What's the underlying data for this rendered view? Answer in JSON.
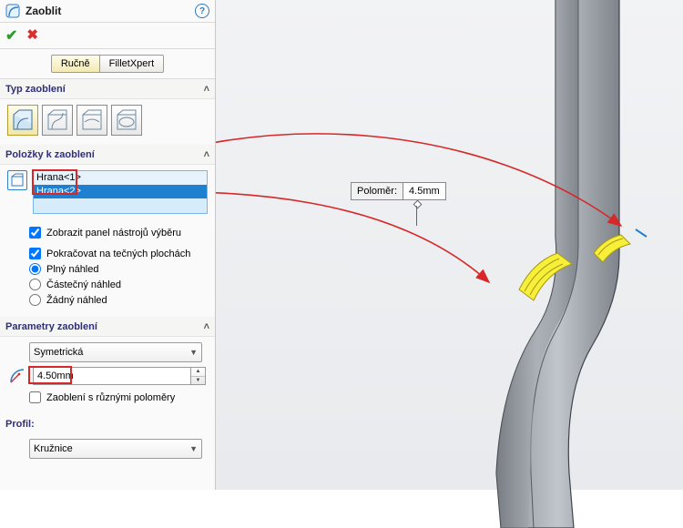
{
  "header": {
    "title": "Zaoblit"
  },
  "tabs": {
    "manual": "Ručně",
    "xpert": "FilletXpert"
  },
  "typeSection": {
    "title": "Typ zaoblení"
  },
  "itemsSection": {
    "title": "Položky k zaoblení",
    "items": [
      "Hrana<1>",
      "Hrana<2>"
    ],
    "showToolbar": "Zobrazit panel nástrojů výběru",
    "tangent": "Pokračovat na tečných plochách",
    "fullPreview": "Plný náhled",
    "partialPreview": "Částečný náhled",
    "noPreview": "Žádný náhled"
  },
  "paramsSection": {
    "title": "Parametry zaoblení",
    "symmetric": "Symetrická",
    "radius": "4.50mm",
    "multi": "Zaoblení s různými poloměry"
  },
  "profileSection": {
    "title": "Profil:",
    "value": "Kružnice"
  },
  "callout": {
    "label": "Poloměr:",
    "value": "4.5mm"
  }
}
